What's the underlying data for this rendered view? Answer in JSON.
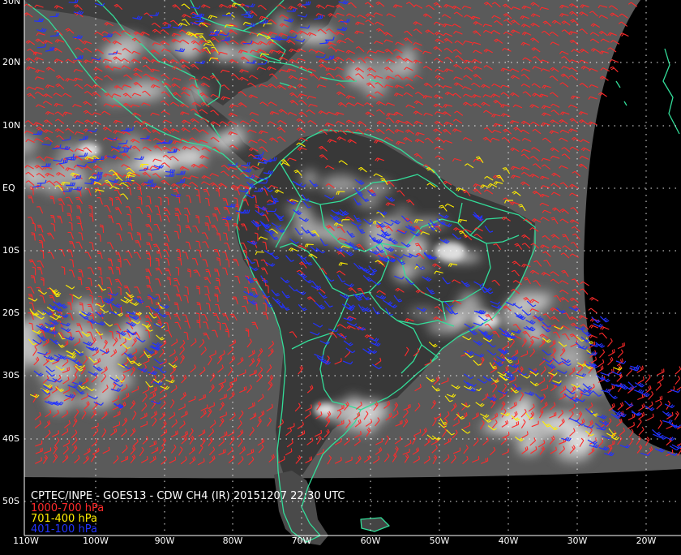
{
  "caption": {
    "title": "CPTEC/INPE - GOES13 - CDW CH4 (IR) 20151207 22:30 UTC"
  },
  "legend": [
    {
      "label": "1000-700 hPa",
      "color": "#ff2a2a"
    },
    {
      "label": "701-400 hPa",
      "color": "#ffee00"
    },
    {
      "label": "401-100 hPa",
      "color": "#2233ff"
    }
  ],
  "latitude_labels": [
    "30N",
    "20N",
    "10N",
    "EQ",
    "10S",
    "20S",
    "30S",
    "40S",
    "50S"
  ],
  "longitude_labels": [
    "110W",
    "100W",
    "90W",
    "80W",
    "70W",
    "60W",
    "50W",
    "40W",
    "30W",
    "20W"
  ],
  "colors": {
    "coastline": "#33dd99",
    "grid": "#ffffff",
    "background": "#000000",
    "imagery": "#555555"
  }
}
